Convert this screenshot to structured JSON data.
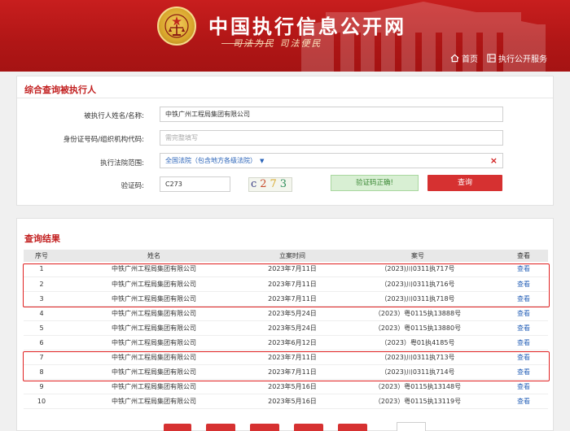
{
  "header": {
    "site_title": "中国执行信息公开网",
    "slogan": "司法为民  司法便民",
    "nav_home": "首页",
    "nav_service": "执行公开服务"
  },
  "query_panel": {
    "title": "综合查询被执行人",
    "name_label": "被执行人姓名/名称:",
    "name_value": "中铁广州工程局集团有限公司",
    "id_label": "身份证号码/组织机构代码:",
    "id_placeholder": "需完整填写",
    "court_label": "执行法院范围:",
    "court_value": "全国法院（包含地方各级法院）",
    "court_clear": "×",
    "captcha_label": "验证码:",
    "captcha_value": "C273",
    "captcha_chars": [
      "c",
      "2",
      "7",
      "3"
    ],
    "verify_status": "验证码正确!",
    "query_button": "查询"
  },
  "results": {
    "title": "查询结果",
    "columns": [
      "序号",
      "姓名",
      "立案时间",
      "案号",
      "查看"
    ],
    "rows": [
      {
        "no": "1",
        "name": "中铁广州工程局集团有限公司",
        "date": "2023年7月11日",
        "case": "（2023)川0311执717号",
        "view": "查看"
      },
      {
        "no": "2",
        "name": "中铁广州工程局集团有限公司",
        "date": "2023年7月11日",
        "case": "（2023)川0311执716号",
        "view": "查看"
      },
      {
        "no": "3",
        "name": "中铁广州工程局集团有限公司",
        "date": "2023年7月11日",
        "case": "（2023)川0311执718号",
        "view": "查看"
      },
      {
        "no": "4",
        "name": "中铁广州工程局集团有限公司",
        "date": "2023年5月24日",
        "case": "（2023）粤0115执13888号",
        "view": "查看"
      },
      {
        "no": "5",
        "name": "中铁广州工程局集团有限公司",
        "date": "2023年5月24日",
        "case": "（2023）粤0115执13880号",
        "view": "查看"
      },
      {
        "no": "6",
        "name": "中铁广州工程局集团有限公司",
        "date": "2023年6月12日",
        "case": "（2023）粤01执4185号",
        "view": "查看"
      },
      {
        "no": "7",
        "name": "中铁广州工程局集团有限公司",
        "date": "2023年7月11日",
        "case": "（2023)川0311执713号",
        "view": "查看"
      },
      {
        "no": "8",
        "name": "中铁广州工程局集团有限公司",
        "date": "2023年7月11日",
        "case": "（2023)川0311执714号",
        "view": "查看"
      },
      {
        "no": "9",
        "name": "中铁广州工程局集团有限公司",
        "date": "2023年5月16日",
        "case": "（2023）粤0115执13148号",
        "view": "查看"
      },
      {
        "no": "10",
        "name": "中铁广州工程局集团有限公司",
        "date": "2023年5月16日",
        "case": "（2023）粤0115执13119号",
        "view": "查看"
      }
    ],
    "highlighted_groups": [
      [
        "1",
        "2",
        "3"
      ],
      [
        "7",
        "8"
      ]
    ]
  },
  "colors": {
    "header_red": "#b01616",
    "accent_red": "#d63131",
    "title_red": "#c22020",
    "link_blue": "#2a63b8",
    "success_green": "#3d8a37",
    "highlight_border": "#e02020"
  }
}
